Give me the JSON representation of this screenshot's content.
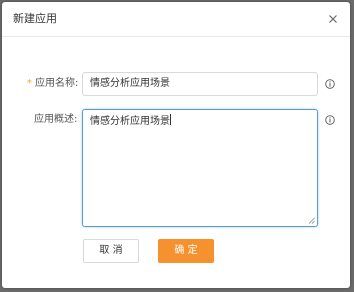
{
  "dialog": {
    "title": "新建应用",
    "close_icon": "close-icon"
  },
  "form": {
    "name": {
      "required_mark": "*",
      "label": "应用名称:",
      "value": "情感分析应用场景",
      "info_icon": "info-icon"
    },
    "description": {
      "label": "应用概述:",
      "value": "情感分析应用场景",
      "info_icon": "info-icon"
    }
  },
  "buttons": {
    "cancel_label": "取 消",
    "ok_label": "确 定"
  },
  "colors": {
    "primary": "#f5922f",
    "required": "#f5a623",
    "focus_border": "#5b9bd5"
  }
}
